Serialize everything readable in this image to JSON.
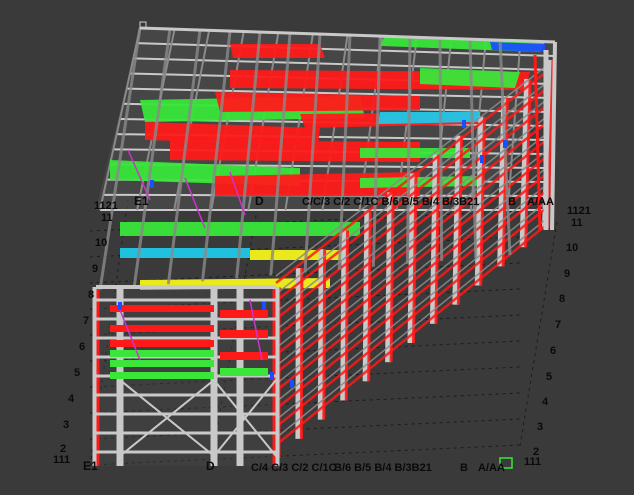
{
  "colors": {
    "background": "#3a3a3a",
    "grid": "#1c1c1c",
    "member": "#c9c9c9",
    "member_dark": "#8a8a8a",
    "red": "#ff1a1a",
    "green": "#39e639",
    "cyan": "#1ec8e8",
    "blue": "#1a4fff",
    "yellow": "#f2f21a",
    "magenta": "#cc33cc",
    "label": "#0a0a0a"
  },
  "labels": {
    "top_left_row": "1121",
    "top_e1": "E1",
    "top_d": "D",
    "top_c": "C/C/3 C/2 C/1C B/6 B/5 B/4 B/3B21",
    "top_b": "B",
    "top_a": "A/AA",
    "top_right_row": "1121",
    "bottom_left_row": "111",
    "bottom_e1": "E1",
    "bottom_d": "D",
    "bottom_c": "C/4 C/3 C/2 C/1C",
    "bottom_b": "B/6 B/5 B/4 B/3B21",
    "bottom_b2": "B",
    "bottom_a": "A/AA",
    "bottom_right_row": "111",
    "left_levels": [
      "11",
      "10",
      "9",
      "8",
      "7",
      "6",
      "5",
      "4",
      "3",
      "2"
    ],
    "right_levels": [
      "11",
      "10",
      "9",
      "8",
      "7",
      "6",
      "5",
      "4",
      "3",
      "2"
    ]
  }
}
